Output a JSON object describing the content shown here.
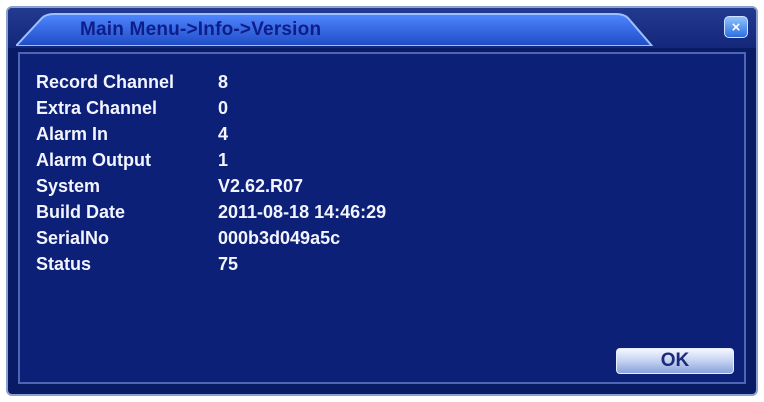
{
  "window": {
    "title": "Main Menu->Info->Version",
    "close_symbol": "×"
  },
  "info": {
    "rows": [
      {
        "label": "Record Channel",
        "value": "8"
      },
      {
        "label": "Extra Channel",
        "value": "0"
      },
      {
        "label": "Alarm In",
        "value": "4"
      },
      {
        "label": "Alarm Output",
        "value": "1"
      },
      {
        "label": "System",
        "value": "V2.62.R07"
      },
      {
        "label": "Build Date",
        "value": "2011-08-18 14:46:29"
      },
      {
        "label": "SerialNo",
        "value": "000b3d049a5c"
      },
      {
        "label": "Status",
        "value": "75"
      }
    ]
  },
  "footer": {
    "ok_label": "OK"
  },
  "colors": {
    "background": "#0d2078",
    "title_tab": "#2f5bd6",
    "text": "#f2f4ff",
    "close_button": "#3b7ff0"
  }
}
